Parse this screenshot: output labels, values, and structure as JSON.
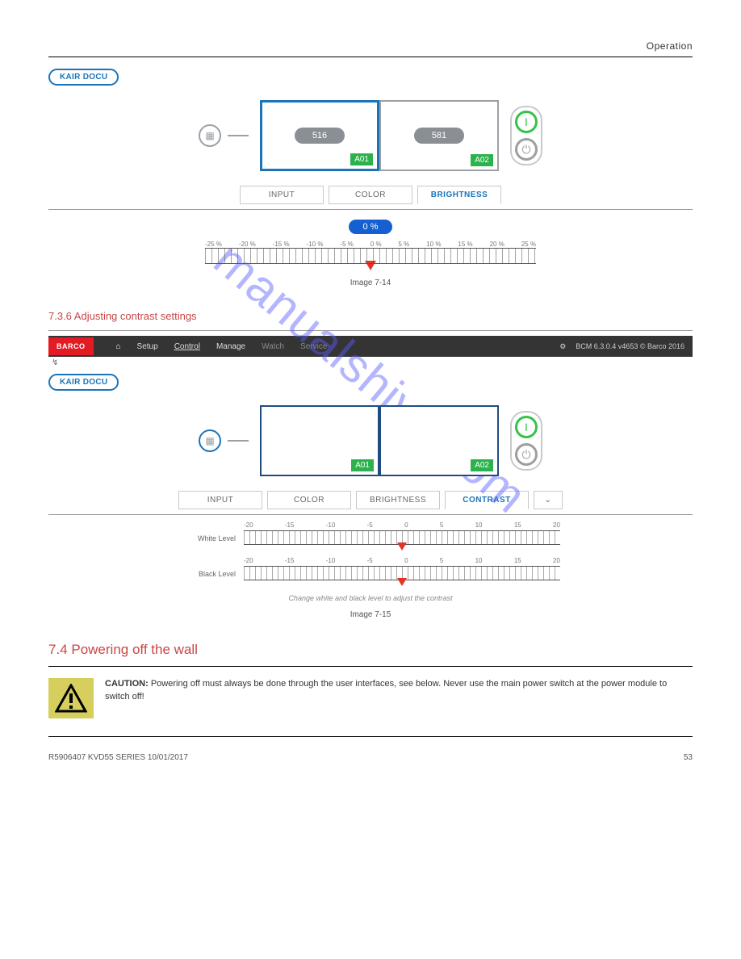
{
  "header": {
    "right": "Operation"
  },
  "kair_label": "KAIR DOCU",
  "watermark": "manualshive.com",
  "fig1": {
    "screens": [
      {
        "num": "516",
        "tag": "A01",
        "active": true
      },
      {
        "num": "581",
        "tag": "A02",
        "active": false
      }
    ],
    "tabs": {
      "input": "INPUT",
      "color": "COLOR",
      "brightness": "BRIGHTNESS"
    },
    "percent": "0 %",
    "scale": [
      "-25 %",
      "-20 %",
      "-15 %",
      "-10 %",
      "-5 %",
      "0 %",
      "5 %",
      "10 %",
      "15 %",
      "20 %",
      "25 %"
    ],
    "caption": "Image 7-14"
  },
  "sect_contrast": {
    "heading": "7.3.6       Adjusting contrast settings"
  },
  "navbar": {
    "brand": "BARCO",
    "items": [
      "Setup",
      "Control",
      "Manage",
      "Watch",
      "Service"
    ],
    "active": "Control",
    "right": "BCM 6.3.0.4 v4653 © Barco 2016"
  },
  "fig2": {
    "screens": [
      {
        "tag": "A01"
      },
      {
        "tag": "A02"
      }
    ],
    "tabs": {
      "input": "INPUT",
      "color": "COLOR",
      "brightness": "BRIGHTNESS",
      "contrast": "CONTRAST"
    },
    "white_label": "White Level",
    "black_label": "Black Level",
    "scale": [
      "-20",
      "-15",
      "-10",
      "-5",
      "0",
      "5",
      "10",
      "15",
      "20"
    ],
    "hint": "Change white and black level to adjust the contrast",
    "caption": "Image 7-15"
  },
  "sect74": {
    "heading": "7.4     Powering off the wall",
    "caution": "CAUTION:",
    "caution_body": "Powering off must always be done through the user interfaces, see below. Never use the main power switch at the power module to switch off!"
  },
  "footer": {
    "left": "R5906407 KVD55 SERIES 10/01/2017",
    "right": "53"
  }
}
